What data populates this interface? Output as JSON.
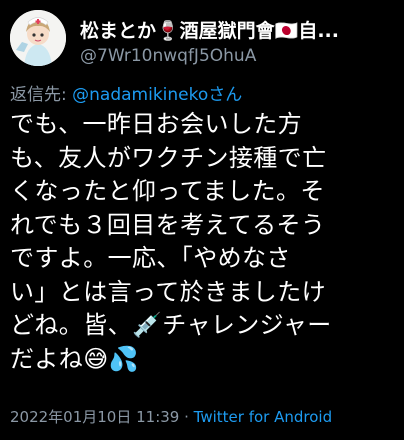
{
  "author": {
    "display_name": "松まとか🍷酒屋獄門會🇯🇵自...",
    "handle": "@7Wr10nwqfJ5OhuA",
    "avatar_icon": "nurse-avatar-icon"
  },
  "reply": {
    "prefix": "返信先: ",
    "mention": "@nadamikinekoさん"
  },
  "tweet": {
    "lines": [
      "でも、一昨日お会いした方",
      "も、友人がワクチン接種で亡",
      "くなったと仰ってました。そ",
      "れでも３回目を考えてるそう",
      "ですよ。一応、「やめなさ",
      "い」とは言って於きましたけ",
      "どね。皆、💉チャレンジャー",
      "だよね😅💦"
    ]
  },
  "meta": {
    "timestamp": "2022年01月10日 11:39",
    "separator": " · ",
    "source": "Twitter for Android"
  },
  "colors": {
    "background": "#000000",
    "text": "#ffffff",
    "muted": "#8b98a5",
    "link": "#1d9bf0"
  }
}
